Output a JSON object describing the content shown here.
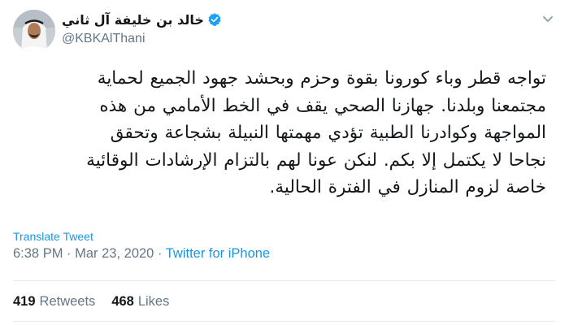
{
  "author": {
    "display_name": "خالد بن خليفة آل ثاني",
    "handle": "@KBKAlThani",
    "verified": true
  },
  "tweet": {
    "lines": [
      "تواجه قطر وباء كورونا بقوة وحزم وبحشد جهود الجميع لحماية",
      "مجتمعنا وبلدنا. جهازنا الصحي يقف في الخط الأمامي من هذه",
      "المواجهة وكوادرنا الطبية تؤدي مهمتها النبيلة بشجاعة وتحقق",
      "نجاحا لا يكتمل إلا بكم. لنكن عونا لهم بالتزام الإرشادات الوقائية",
      "خاصة لزوم المنازل في الفترة الحالية."
    ],
    "translate_label": "Translate Tweet",
    "time": "6:38 PM",
    "separator": " · ",
    "date": "Mar 23, 2020",
    "source": "Twitter for iPhone"
  },
  "stats": {
    "retweets_count": "419",
    "retweets_label": "Retweets",
    "likes_count": "468",
    "likes_label": "Likes"
  },
  "colors": {
    "link": "#1b95e0",
    "muted": "#657786",
    "text": "#14171a",
    "verified": "#1da1f2"
  },
  "icons": {
    "more": "chevron-down-icon",
    "verified": "verified-badge-icon"
  }
}
